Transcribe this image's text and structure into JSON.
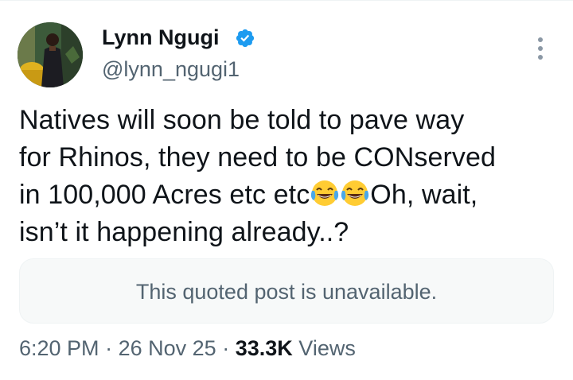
{
  "author": {
    "display_name": "Lynn Ngugi",
    "handle": "@lynn_ngugi1",
    "verified": true,
    "verified_color": "#1d9bf0"
  },
  "tweet": {
    "lines": [
      "Natives will soon be told to pave way",
      "for Rhinos, they need to be CONserved",
      "in 100,000 Acres etc etc",
      "Oh, wait,",
      "isn’t it happening already..?"
    ],
    "emoji": "face-with-tears-of-joy-icon"
  },
  "quote": {
    "text": "This quoted post is unavailable."
  },
  "meta": {
    "time": "6:20 PM",
    "separator": "·",
    "date": "26 Nov 25",
    "views_count": "33.3K",
    "views_label": "Views"
  },
  "colors": {
    "text_primary": "#0f1419",
    "text_secondary": "#536471",
    "quote_bg": "#f7f9f9"
  }
}
